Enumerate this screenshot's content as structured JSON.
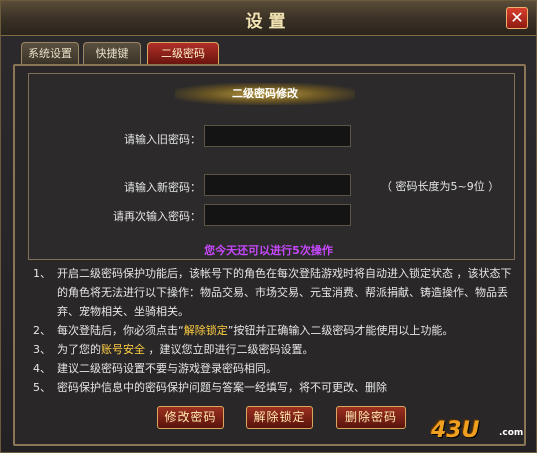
{
  "window": {
    "title": "设置",
    "close_label": "✕"
  },
  "tabs": [
    {
      "label": "系统设置",
      "active": false
    },
    {
      "label": "快捷键",
      "active": false
    },
    {
      "label": "二级密码",
      "active": true
    }
  ],
  "form": {
    "header": "二级密码修改",
    "old_password_label": "请输入旧密码：",
    "new_password_label": "请输入新密码：",
    "confirm_password_label": "请再次输入密码：",
    "old_password_value": "",
    "new_password_value": "",
    "confirm_password_value": "",
    "length_hint": "（ 密码长度为5~9位 ）",
    "remaining_notice": "您今天还可以进行5次操作"
  },
  "info": [
    {
      "num": "1、",
      "text": "开启二级密码保护功能后，该帐号下的角色在每次登陆游戏时将自动进入锁定状态 ，该状态下的角色将无法进行以下操作：物品交易、市场交易、元宝消费、帮派捐献、铸造操作、物品丢弃、宠物相关、坐骑相关。"
    },
    {
      "num": "2、",
      "text_parts": [
        "每次登陆后，你必须点击“",
        "解除锁定",
        "”按钮并正确输入二级密码才能使用以上功能。"
      ]
    },
    {
      "num": "3、",
      "text_parts": [
        "为了您的",
        "账号安全",
        " ，建议您立即进行二级密码设置。"
      ]
    },
    {
      "num": "4、",
      "text": "建议二级密码设置不要与游戏登录密码相同。"
    },
    {
      "num": "5、",
      "text": "密码保护信息中的密码保护问题与答案一经填写，将不可更改、删除"
    }
  ],
  "buttons": {
    "modify": "修改密码",
    "unlock": "解除锁定",
    "delete": "删除密码"
  },
  "watermark": {
    "main": "43U",
    "suffix": ".com"
  },
  "colors": {
    "accent_red": "#a02c20",
    "notice_purple": "#c848ff",
    "gold": "#d8a860"
  }
}
